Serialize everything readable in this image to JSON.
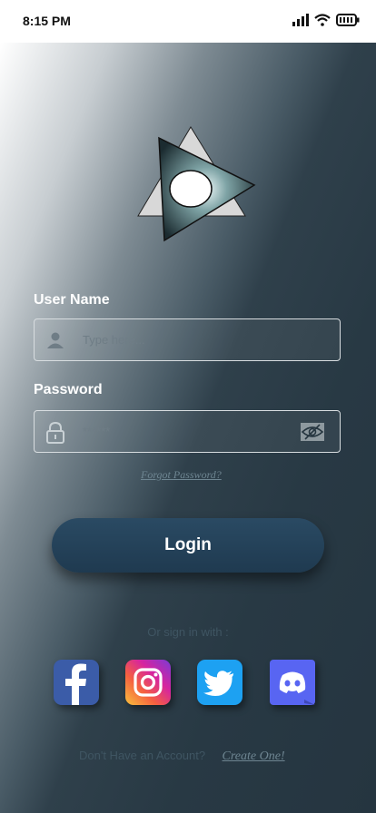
{
  "status": {
    "time": "8:15 PM"
  },
  "form": {
    "username_label": "User Name",
    "username_placeholder": "Type here...",
    "password_label": "Password",
    "password_placeholder": "******",
    "forgot": "Forgot Password?",
    "login": "Login"
  },
  "social": {
    "heading": "Or sign in with :",
    "items": [
      "facebook-icon",
      "instagram-icon",
      "twitter-icon",
      "discord-icon"
    ]
  },
  "footer": {
    "question": "Don't Have an Account?",
    "cta": "Create One!"
  },
  "colors": {
    "background": "#263640",
    "button": "#234259",
    "facebook": "#3b5ca8",
    "twitter": "#1da1f2",
    "discord": "#5865f2"
  }
}
